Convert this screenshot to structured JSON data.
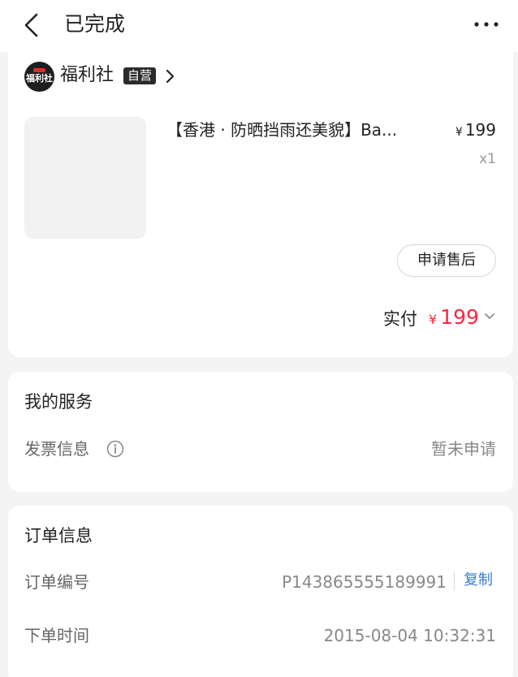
{
  "header": {
    "back_icon": "chevron-left-icon",
    "title": "已完成",
    "more_icon": "more-icon"
  },
  "shop": {
    "logo_text": "福利社",
    "name": "福利社",
    "badge": "自营",
    "chevron_icon": "chevron-right-icon"
  },
  "product": {
    "title": "【香港 · 防晒挡雨还美貌】Ba...",
    "currency": "¥",
    "price": "199",
    "quantity": "x1"
  },
  "actions": {
    "after_sale_label": "申请售后"
  },
  "payment": {
    "label": "实付",
    "currency": "¥",
    "amount": "199"
  },
  "services": {
    "title": "我的服务",
    "invoice_label": "发票信息",
    "invoice_status": "暂未申请"
  },
  "order_info": {
    "title": "订单信息",
    "number_label": "订单编号",
    "number_value": "P143865555189991",
    "copy_label": "复制",
    "time_label": "下单时间",
    "time_value": "2015-08-04 10:32:31"
  },
  "colors": {
    "accent_price": "#ff2442",
    "link_blue": "#3a7bd5",
    "page_background": "#f4f4f4",
    "badge_background": "#2b2b2b"
  }
}
